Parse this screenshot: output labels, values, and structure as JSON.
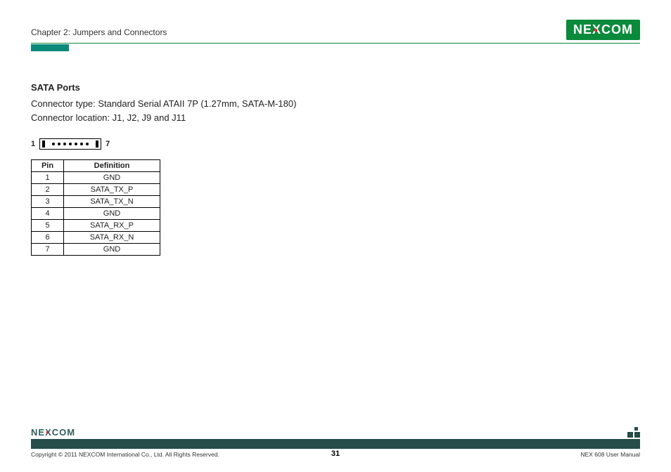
{
  "header": {
    "chapter": "Chapter 2: Jumpers and Connectors",
    "logo": "NEXCOM"
  },
  "section": {
    "title": "SATA Ports",
    "line1": "Connector type: Standard Serial ATAII 7P (1.27mm, SATA-M-180)",
    "line2": "Connector location: J1, J2, J9 and J11"
  },
  "figure": {
    "left_num": "1",
    "right_num": "7"
  },
  "table": {
    "headers": [
      "Pin",
      "Definition"
    ],
    "rows": [
      {
        "pin": "1",
        "def": "GND"
      },
      {
        "pin": "2",
        "def": "SATA_TX_P"
      },
      {
        "pin": "3",
        "def": "SATA_TX_N"
      },
      {
        "pin": "4",
        "def": "GND"
      },
      {
        "pin": "5",
        "def": "SATA_RX_P"
      },
      {
        "pin": "6",
        "def": "SATA_RX_N"
      },
      {
        "pin": "7",
        "def": "GND"
      }
    ]
  },
  "footer": {
    "logo": "NEXCOM",
    "copyright": "Copyright © 2011 NEXCOM International Co., Ltd. All Rights Reserved.",
    "page_num": "31",
    "manual": "NEX 608 User Manual"
  }
}
